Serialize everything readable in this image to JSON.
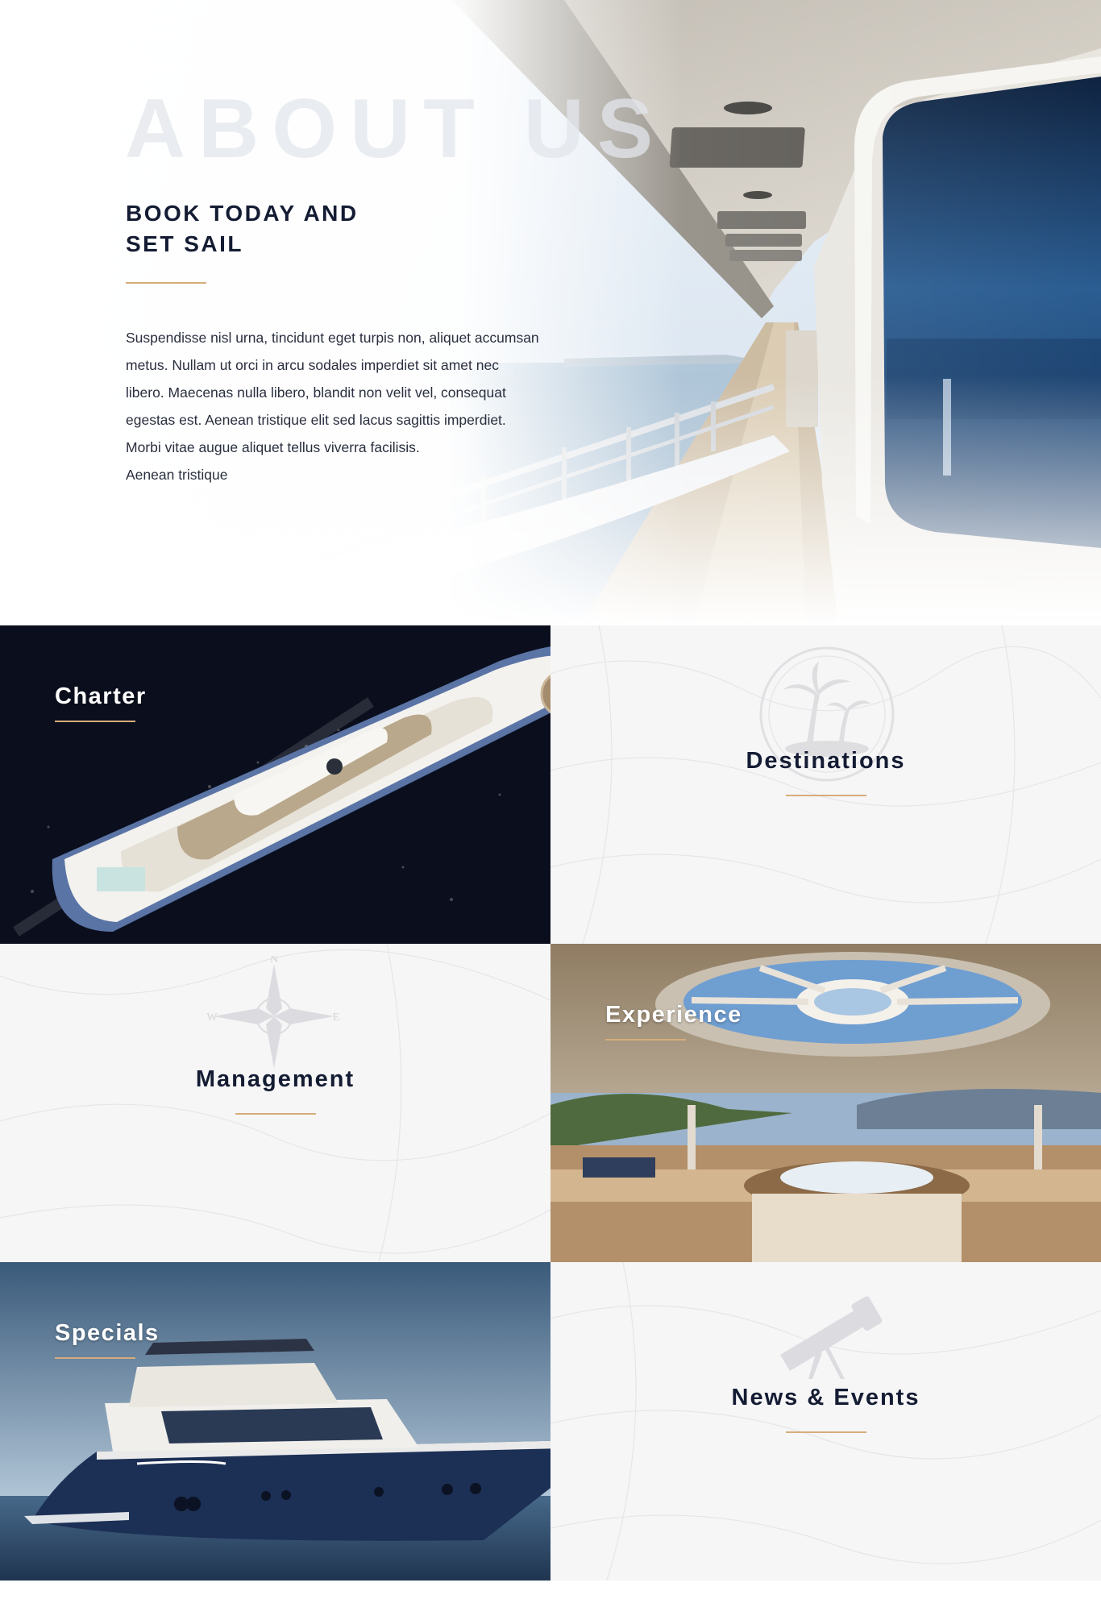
{
  "about": {
    "watermark": "ABOUT US",
    "title_line1": "BOOK TODAY AND",
    "title_line2": "SET SAIL",
    "paragraph_lines": [
      "Suspendisse nisl urna, tincidunt eget turpis non, aliquet accumsan",
      "metus. Nullam ut orci in arcu sodales imperdiet sit amet nec",
      "libero. Maecenas nulla libero, blandit non velit vel, consequat",
      "egestas est. Aenean tristique elit sed lacus sagittis imperdiet.",
      "Morbi vitae augue aliquet tellus viverra facilisis.",
      "Aenean tristique"
    ]
  },
  "tiles": {
    "charter": "Charter",
    "destinations": "Destinations",
    "management": "Management",
    "experience": "Experience",
    "specials": "Specials",
    "news_events": "News & Events"
  },
  "colors": {
    "navy": "#141c33",
    "accent": "#d6ac7b",
    "tile_light": "#f6f6f7"
  },
  "icons": {
    "destinations": "palm-tree-icon",
    "management": "compass-rose-icon",
    "news_events": "telescope-icon"
  }
}
